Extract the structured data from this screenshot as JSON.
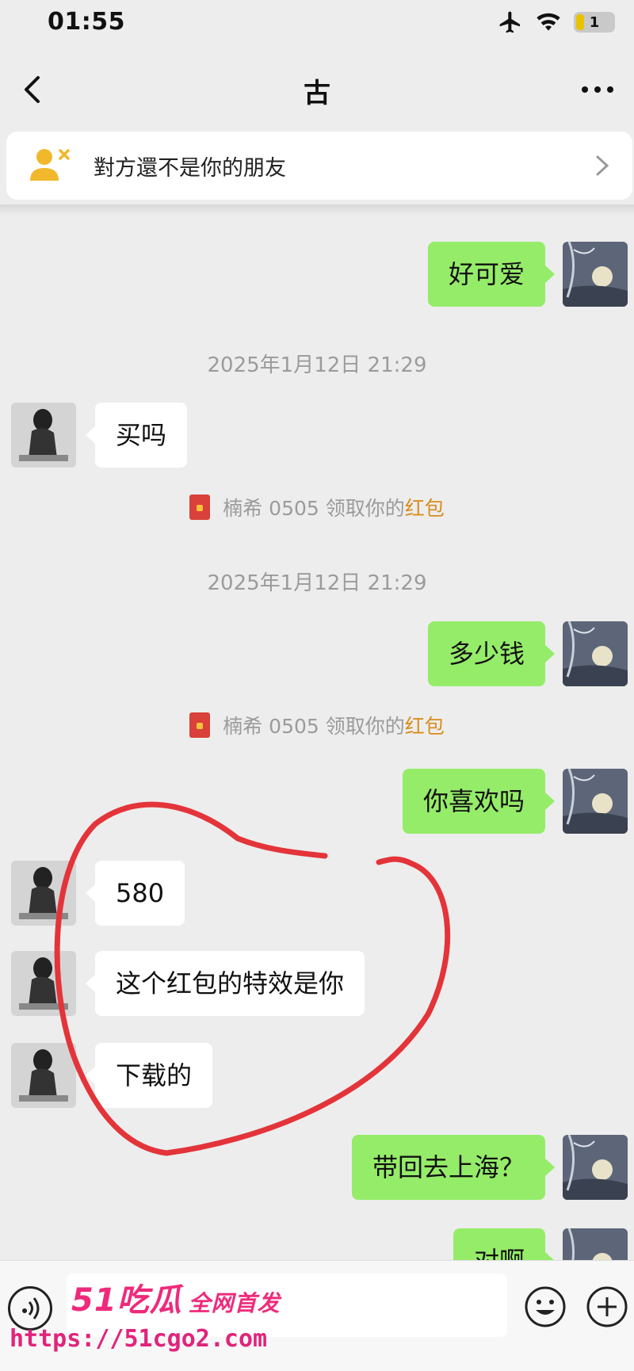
{
  "status_bar": {
    "time": "01:55",
    "battery_level": "1"
  },
  "nav": {
    "title": "古"
  },
  "banner": {
    "text": "對方還不是你的朋友"
  },
  "messages": [
    {
      "text": "好可爱"
    },
    {
      "text": "买吗"
    },
    {
      "text": "多少钱"
    },
    {
      "text": "你喜欢吗"
    },
    {
      "text": "580"
    },
    {
      "text": "这个红包的特效是你"
    },
    {
      "text": "下载的"
    },
    {
      "text": "带回去上海？"
    },
    {
      "text": "对啊"
    }
  ],
  "timestamps": [
    "2025年1月12日 21:29",
    "2025年1月12日 21:29"
  ],
  "system_notices": [
    {
      "prefix": "楠希 0505 领取你的",
      "highlight": "红包"
    },
    {
      "prefix": "楠希 0505 领取你的",
      "highlight": "红包"
    }
  ],
  "watermark": {
    "brand": "51吃瓜",
    "tagline": "全网首发",
    "url": "https://51cgo2.com"
  },
  "colors": {
    "outgoing_bubble": "#95ec69",
    "incoming_bubble": "#ffffff",
    "background": "#ededed",
    "annotation": "#e3343a",
    "watermark": "#ee2a7b"
  },
  "icons": [
    "back-arrow-icon",
    "more-icon",
    "user-x-icon",
    "chevron-right-icon",
    "red-packet-icon",
    "voice-icon",
    "emoji-icon",
    "plus-icon",
    "airplane-icon",
    "wifi-icon",
    "battery-icon"
  ]
}
